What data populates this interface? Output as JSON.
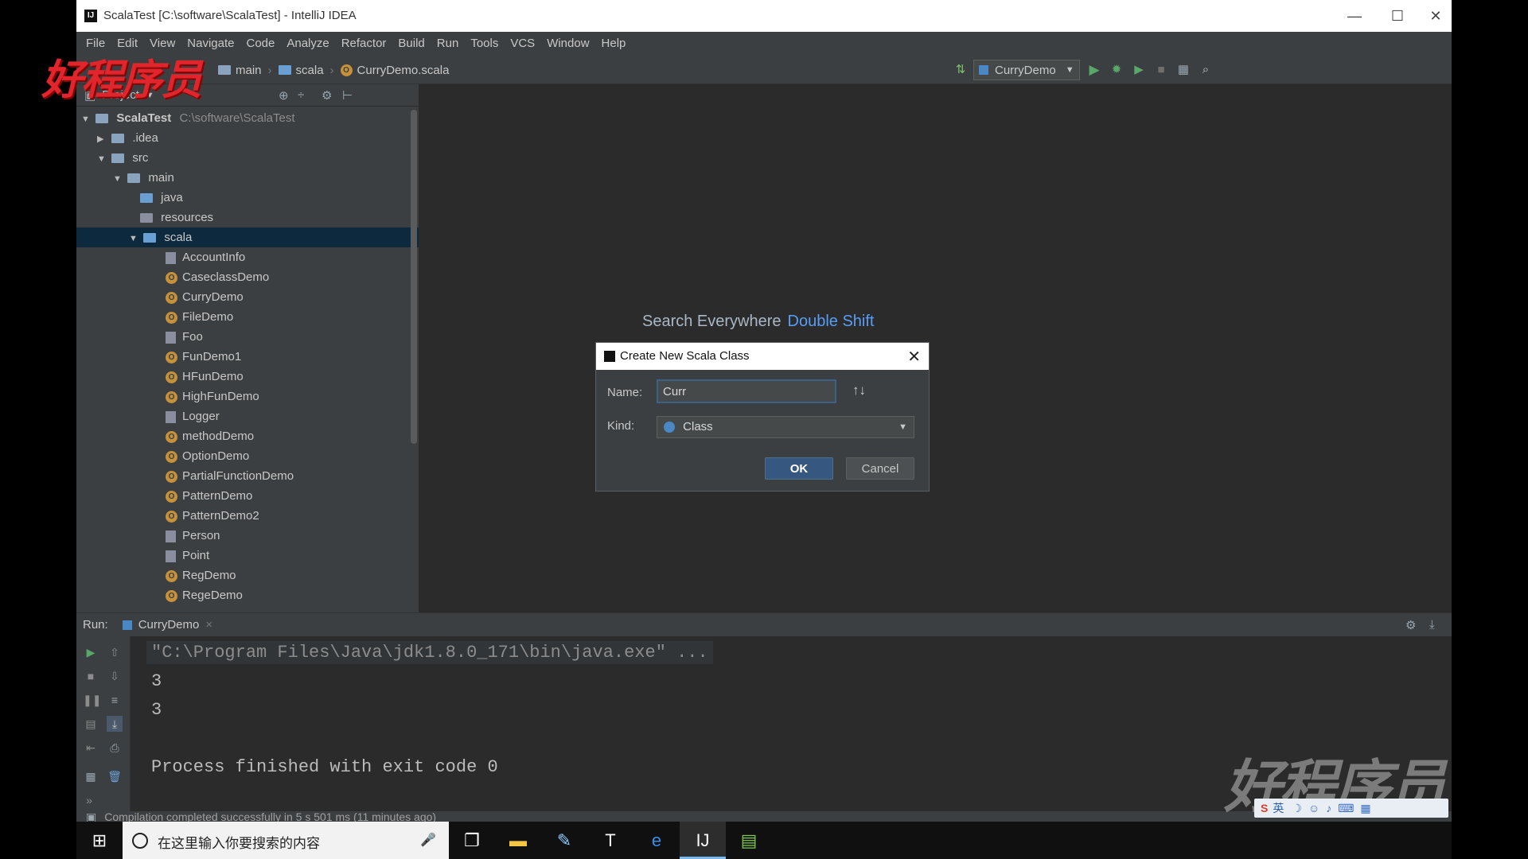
{
  "window": {
    "title": "ScalaTest [C:\\software\\ScalaTest] - IntelliJ IDEA",
    "minimize": "—",
    "maximize": "☐",
    "close": "✕"
  },
  "menu": [
    "File",
    "Edit",
    "View",
    "Navigate",
    "Code",
    "Analyze",
    "Refactor",
    "Build",
    "Run",
    "Tools",
    "VCS",
    "Window",
    "Help"
  ],
  "breadcrumb": {
    "items": [
      "main",
      "scala",
      "CurryDemo.scala"
    ],
    "sep": "›"
  },
  "toolbar": {
    "run_config": "CurryDemo"
  },
  "project": {
    "tab_label": "Project",
    "root_name": "ScalaTest",
    "root_path": "C:\\software\\ScalaTest",
    "nodes": [
      ".idea",
      "src",
      "main",
      "java",
      "resources",
      "scala"
    ],
    "files": [
      "AccountInfo",
      "CaseclassDemo",
      "CurryDemo",
      "FileDemo",
      "Foo",
      "FunDemo1",
      "HFunDemo",
      "HighFunDemo",
      "Logger",
      "methodDemo",
      "OptionDemo",
      "PartialFunctionDemo",
      "PatternDemo",
      "PatternDemo2",
      "Person",
      "Point",
      "RegDemo",
      "RegeDemo"
    ]
  },
  "editor": {
    "hint": "Search Everywhere",
    "hint_key": "Double Shift"
  },
  "dialog": {
    "title": "Create New Scala Class",
    "close": "✕",
    "name_label": "Name:",
    "name_value": "Curr",
    "kind_label": "Kind:",
    "kind_value": "Class",
    "ok": "OK",
    "cancel": "Cancel"
  },
  "run": {
    "label": "Run:",
    "tab": "CurryDemo",
    "tab_close": "×",
    "lines": [
      "\"C:\\Program Files\\Java\\jdk1.8.0_171\\bin\\java.exe\" ...",
      "3",
      "3",
      "Process finished with exit code 0"
    ]
  },
  "status": {
    "text": "Compilation completed successfully in 5 s 501 ms (11 minutes ago)"
  },
  "taskbar": {
    "search_placeholder": "在这里输入你要搜索的内容"
  },
  "watermark": {
    "logo": "好程序员",
    "ime": "英"
  }
}
